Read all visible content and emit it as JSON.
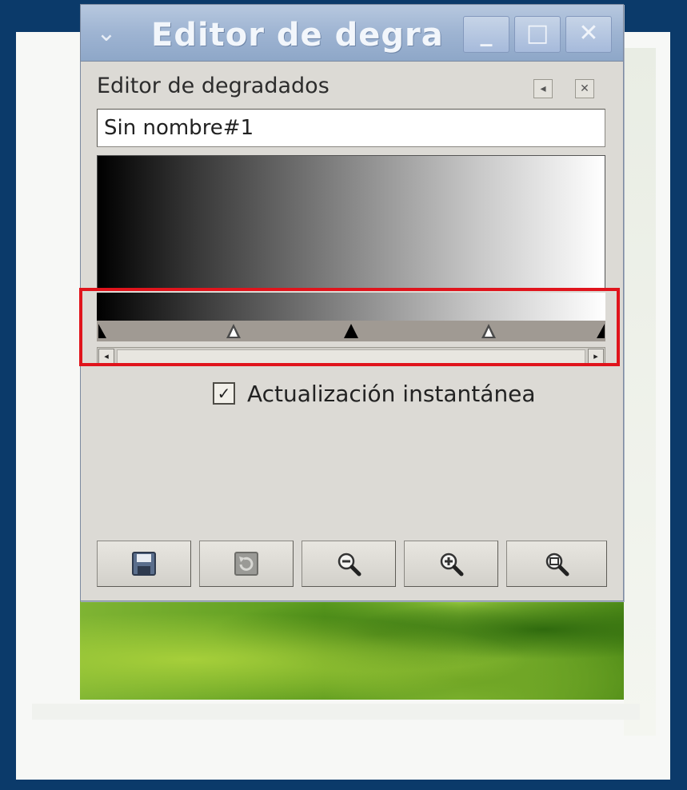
{
  "window": {
    "title": "Editor de degra",
    "menu_icon": "⌄",
    "minimize_label": "_",
    "maximize_label": "□",
    "close_label": "✕"
  },
  "dock": {
    "title": "Editor de degradados",
    "menu_icon": "◂",
    "close_icon": "✕"
  },
  "gradient": {
    "name_value": "Sin nombre#1",
    "start_color": "#000000",
    "end_color": "#ffffff",
    "stops": [
      "left-endpoint",
      "midpoint",
      "center-stop",
      "midpoint",
      "right-endpoint"
    ]
  },
  "scrollbar": {
    "left_arrow": "◂",
    "right_arrow": "▸"
  },
  "instant_update": {
    "checked": true,
    "check_glyph": "✓",
    "label": "Actualización instantánea"
  },
  "toolbar": {
    "buttons": [
      "save-icon",
      "revert-icon",
      "zoom-out-icon",
      "zoom-in-icon",
      "zoom-all-icon"
    ]
  },
  "highlight_color": "#e0141c"
}
